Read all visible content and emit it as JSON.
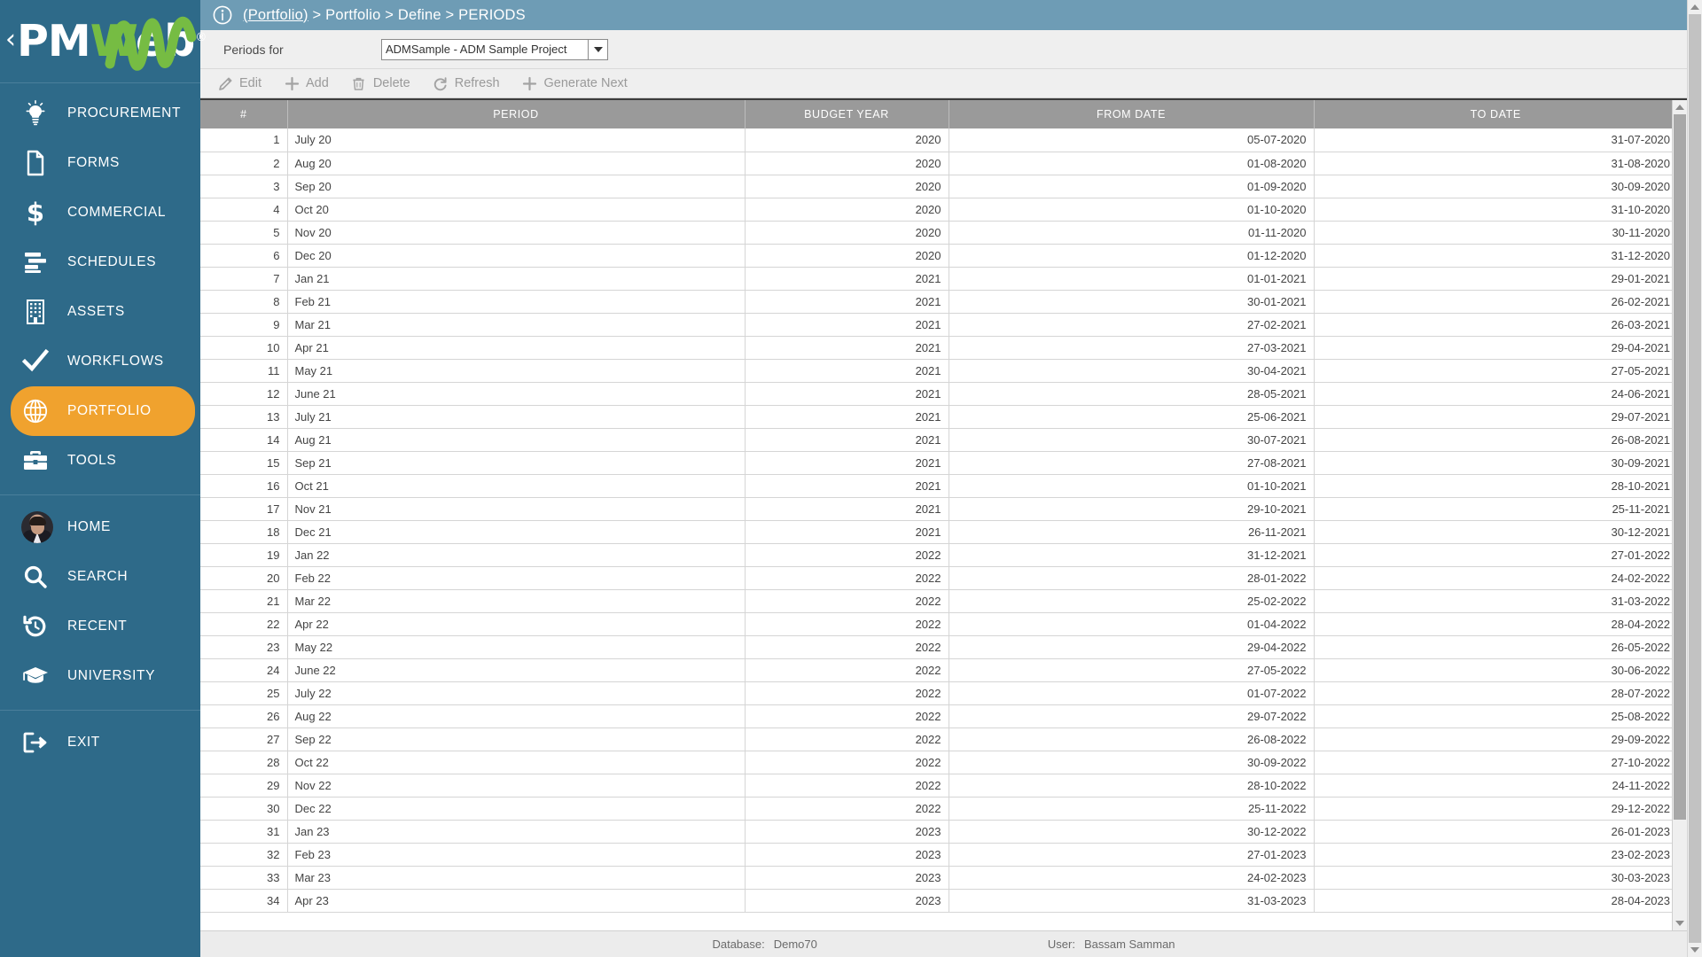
{
  "brand": {
    "name_part1": "PM",
    "name_w": "W",
    "name_part2": "eb",
    "registered": "®",
    "chevron": "‹"
  },
  "topbar": {
    "info_icon": "info-icon",
    "breadcrumb_link": "(Portfolio)",
    "breadcrumb_rest": " > Portfolio > Define > PERIODS"
  },
  "filter": {
    "label": "Periods for",
    "selected": "ADMSample - ADM Sample Project",
    "dropdown_icon": "chevron-down-icon"
  },
  "toolbar": {
    "buttons": [
      {
        "label": "Edit",
        "icon": "pencil-icon"
      },
      {
        "label": "Add",
        "icon": "plus-icon"
      },
      {
        "label": "Delete",
        "icon": "trash-icon"
      },
      {
        "label": "Refresh",
        "icon": "refresh-icon"
      },
      {
        "label": "Generate Next",
        "icon": "plus-icon"
      }
    ]
  },
  "sidebar": {
    "items": [
      {
        "label": "PROCUREMENT",
        "icon": "lightbulb-icon",
        "active": false
      },
      {
        "label": "FORMS",
        "icon": "document-icon",
        "active": false
      },
      {
        "label": "COMMERCIAL",
        "icon": "dollar-icon",
        "active": false
      },
      {
        "label": "SCHEDULES",
        "icon": "schedule-bars-icon",
        "active": false
      },
      {
        "label": "ASSETS",
        "icon": "building-icon",
        "active": false
      },
      {
        "label": "WORKFLOWS",
        "icon": "checkmark-icon",
        "active": false
      },
      {
        "label": "PORTFOLIO",
        "icon": "globe-icon",
        "active": true
      },
      {
        "label": "TOOLS",
        "icon": "toolbox-icon",
        "active": false
      }
    ],
    "user_items": [
      {
        "label": "HOME",
        "icon": "user-avatar"
      },
      {
        "label": "SEARCH",
        "icon": "search-icon"
      },
      {
        "label": "RECENT",
        "icon": "history-icon"
      },
      {
        "label": "UNIVERSITY",
        "icon": "graduation-cap-icon"
      }
    ],
    "exit_item": {
      "label": "EXIT",
      "icon": "exit-icon"
    }
  },
  "grid": {
    "columns": [
      "#",
      "PERIOD",
      "BUDGET YEAR",
      "FROM DATE",
      "TO DATE"
    ],
    "rows": [
      [
        "1",
        "July 20",
        "2020",
        "05-07-2020",
        "31-07-2020"
      ],
      [
        "2",
        "Aug 20",
        "2020",
        "01-08-2020",
        "31-08-2020"
      ],
      [
        "3",
        "Sep 20",
        "2020",
        "01-09-2020",
        "30-09-2020"
      ],
      [
        "4",
        "Oct 20",
        "2020",
        "01-10-2020",
        "31-10-2020"
      ],
      [
        "5",
        "Nov 20",
        "2020",
        "01-11-2020",
        "30-11-2020"
      ],
      [
        "6",
        "Dec 20",
        "2020",
        "01-12-2020",
        "31-12-2020"
      ],
      [
        "7",
        "Jan 21",
        "2021",
        "01-01-2021",
        "29-01-2021"
      ],
      [
        "8",
        "Feb 21",
        "2021",
        "30-01-2021",
        "26-02-2021"
      ],
      [
        "9",
        "Mar 21",
        "2021",
        "27-02-2021",
        "26-03-2021"
      ],
      [
        "10",
        "Apr 21",
        "2021",
        "27-03-2021",
        "29-04-2021"
      ],
      [
        "11",
        "May 21",
        "2021",
        "30-04-2021",
        "27-05-2021"
      ],
      [
        "12",
        "June 21",
        "2021",
        "28-05-2021",
        "24-06-2021"
      ],
      [
        "13",
        "July 21",
        "2021",
        "25-06-2021",
        "29-07-2021"
      ],
      [
        "14",
        "Aug 21",
        "2021",
        "30-07-2021",
        "26-08-2021"
      ],
      [
        "15",
        "Sep 21",
        "2021",
        "27-08-2021",
        "30-09-2021"
      ],
      [
        "16",
        "Oct 21",
        "2021",
        "01-10-2021",
        "28-10-2021"
      ],
      [
        "17",
        "Nov 21",
        "2021",
        "29-10-2021",
        "25-11-2021"
      ],
      [
        "18",
        "Dec 21",
        "2021",
        "26-11-2021",
        "30-12-2021"
      ],
      [
        "19",
        "Jan 22",
        "2022",
        "31-12-2021",
        "27-01-2022"
      ],
      [
        "20",
        "Feb 22",
        "2022",
        "28-01-2022",
        "24-02-2022"
      ],
      [
        "21",
        "Mar 22",
        "2022",
        "25-02-2022",
        "31-03-2022"
      ],
      [
        "22",
        "Apr 22",
        "2022",
        "01-04-2022",
        "28-04-2022"
      ],
      [
        "23",
        "May 22",
        "2022",
        "29-04-2022",
        "26-05-2022"
      ],
      [
        "24",
        "June 22",
        "2022",
        "27-05-2022",
        "30-06-2022"
      ],
      [
        "25",
        "July 22",
        "2022",
        "01-07-2022",
        "28-07-2022"
      ],
      [
        "26",
        "Aug 22",
        "2022",
        "29-07-2022",
        "25-08-2022"
      ],
      [
        "27",
        "Sep 22",
        "2022",
        "26-08-2022",
        "29-09-2022"
      ],
      [
        "28",
        "Oct 22",
        "2022",
        "30-09-2022",
        "27-10-2022"
      ],
      [
        "29",
        "Nov 22",
        "2022",
        "28-10-2022",
        "24-11-2022"
      ],
      [
        "30",
        "Dec 22",
        "2022",
        "25-11-2022",
        "29-12-2022"
      ],
      [
        "31",
        "Jan 23",
        "2023",
        "30-12-2022",
        "26-01-2023"
      ],
      [
        "32",
        "Feb 23",
        "2023",
        "27-01-2023",
        "23-02-2023"
      ],
      [
        "33",
        "Mar 23",
        "2023",
        "24-02-2023",
        "30-03-2023"
      ],
      [
        "34",
        "Apr 23",
        "2023",
        "31-03-2023",
        "28-04-2023"
      ]
    ]
  },
  "statusbar": {
    "database_key": "Database:",
    "database_value": "Demo70",
    "user_key": "User:",
    "user_value": "Bassam Samman"
  },
  "colors": {
    "sidebar_bg": "#2e6a89",
    "topbar_bg": "#6e9cb5",
    "accent_orange": "#f0a22e",
    "logo_green": "#76bc43",
    "header_gray": "#9a9a9a",
    "panel_gray": "#efefef"
  }
}
